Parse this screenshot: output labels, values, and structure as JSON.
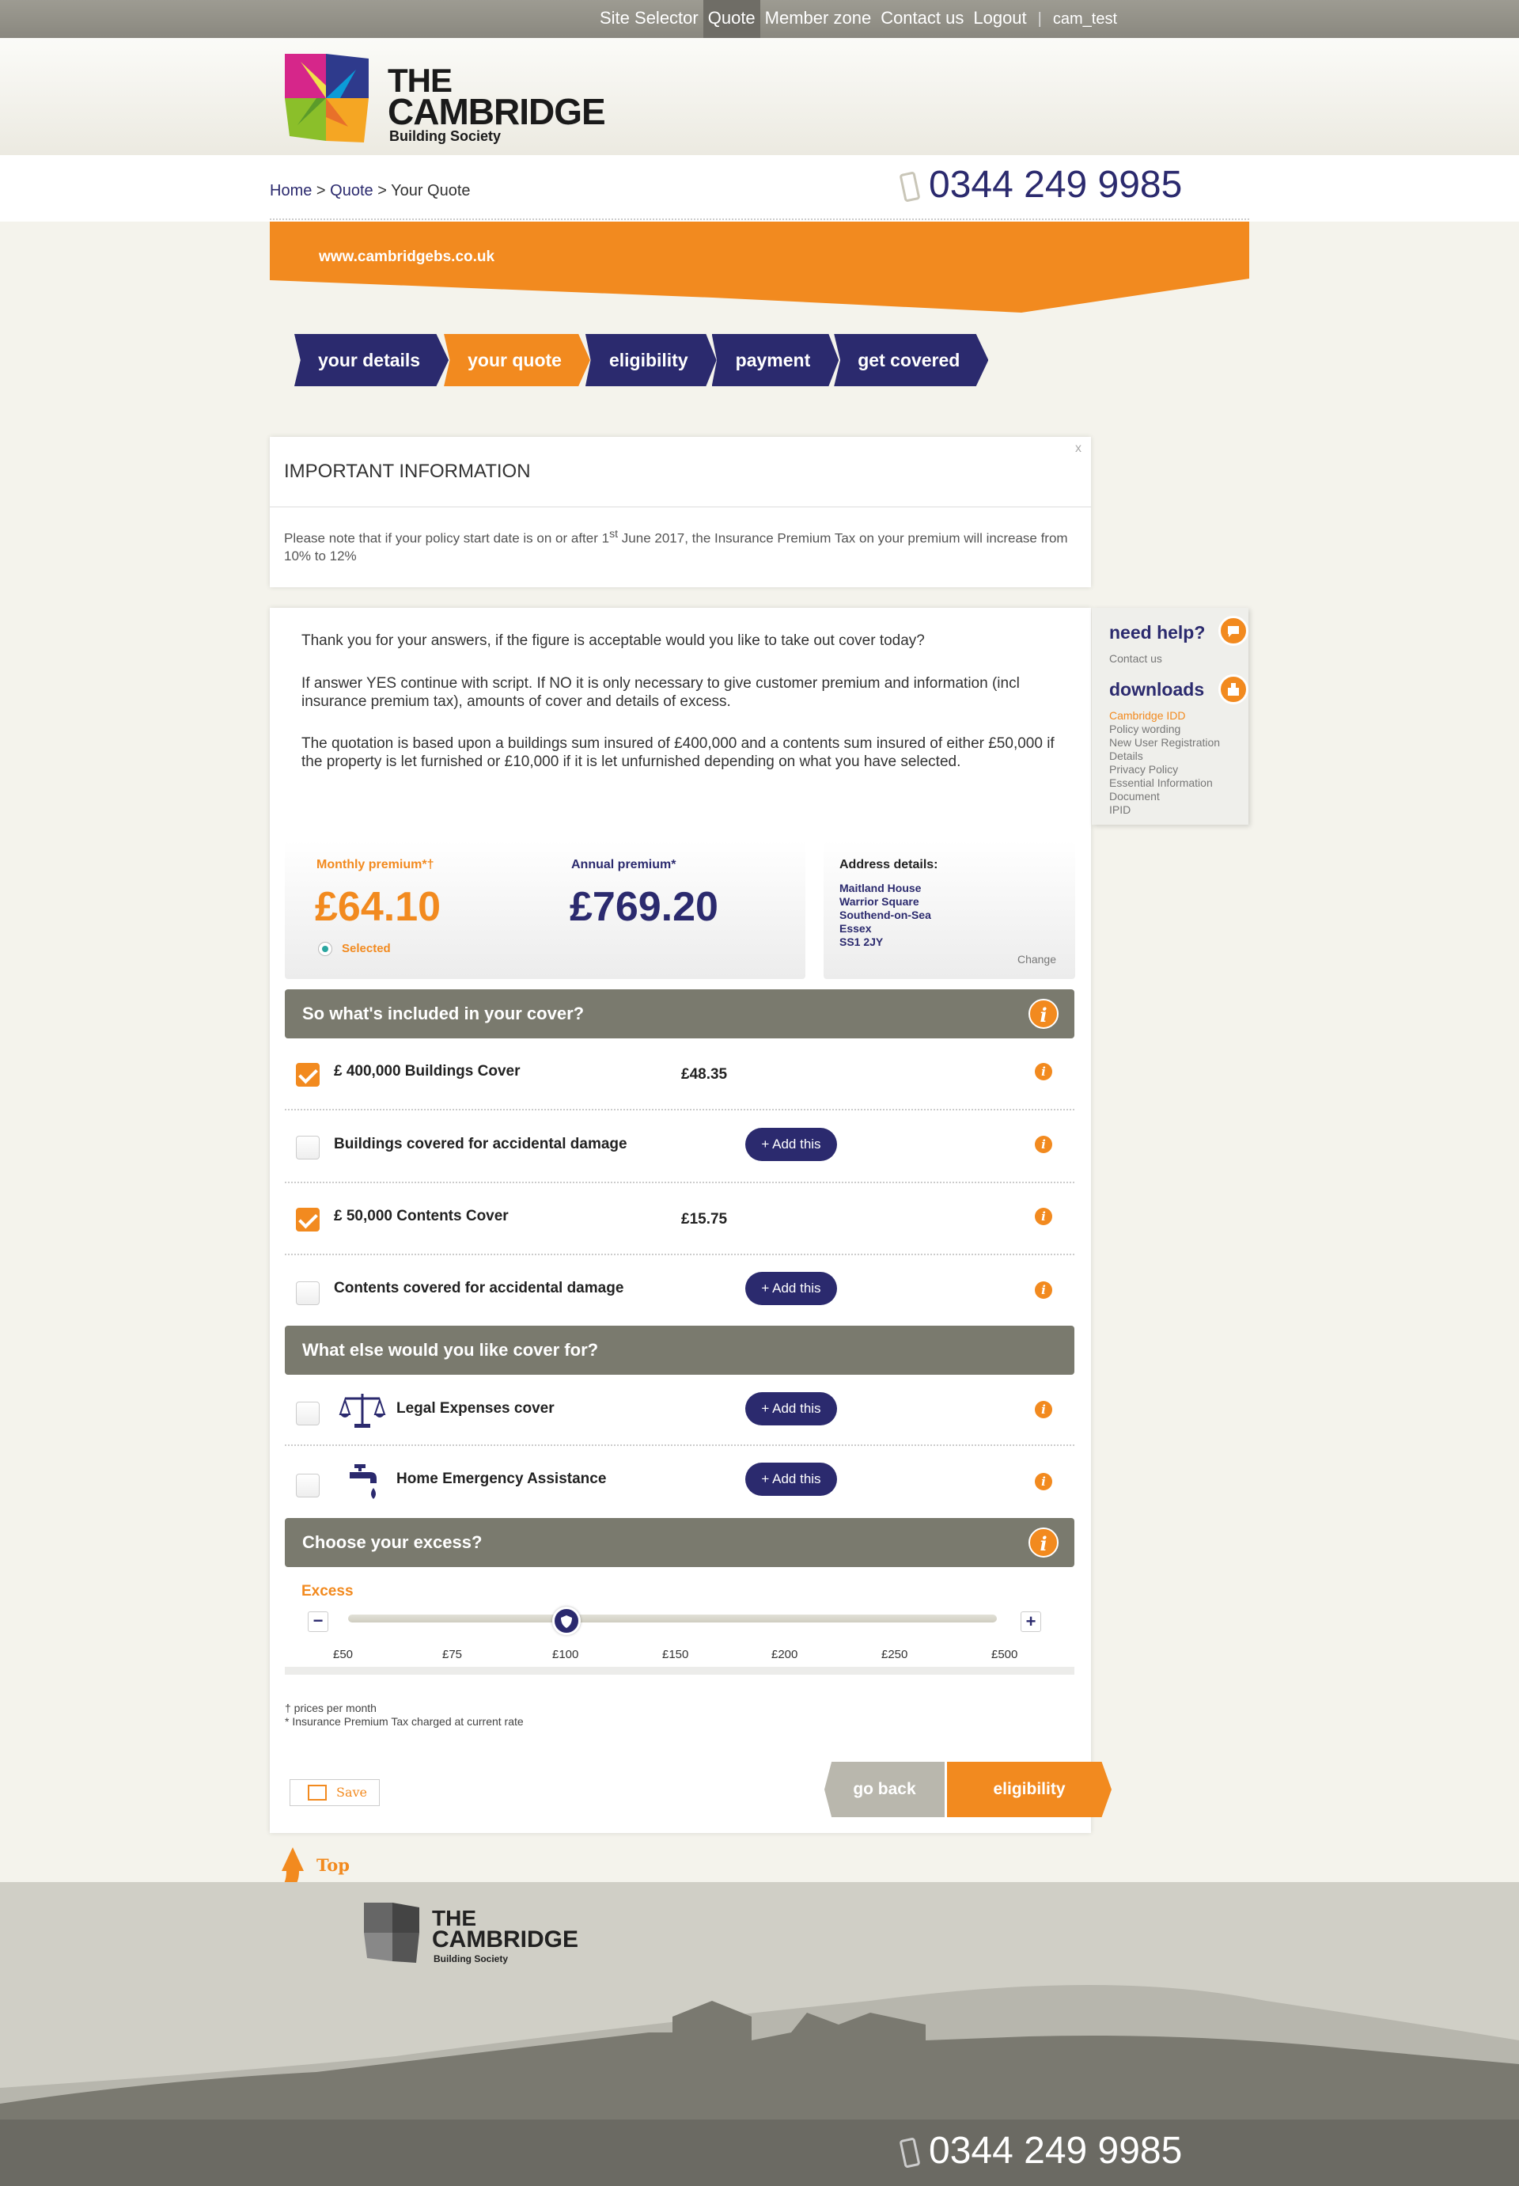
{
  "topnav": {
    "items": [
      "Site Selector",
      "Quote",
      "Member zone",
      "Contact us",
      "Logout"
    ],
    "active": "Quote",
    "user": "cam_test"
  },
  "logo": {
    "line1": "THE",
    "line2": "CAMBRIDGE",
    "line3": "Building Society"
  },
  "breadcrumb": {
    "home": "Home",
    "sep1": " > ",
    "quote": "Quote",
    "sep2": " > ",
    "current": "Your Quote"
  },
  "phone": "0344 249 9985",
  "banner": {
    "url": "www.cambridgebs.co.uk"
  },
  "steps": [
    "your details",
    "your quote",
    "eligibility",
    "payment",
    "get covered"
  ],
  "important": {
    "title": "IMPORTANT INFORMATION",
    "close": "x",
    "text_before": "Please note that if your policy start date is on or after 1",
    "sup": "st",
    "text_after": " June 2017, the Insurance Premium Tax on your premium will increase from 10% to 12%"
  },
  "script": {
    "p1": "Thank you for your answers, if the figure is acceptable would you like to take out cover today?",
    "p2": "If answer YES continue with script. If NO it is only necessary to give customer premium and information (incl insurance premium tax), amounts of cover and details of excess.",
    "p3": "The quotation is based upon a buildings sum insured of £400,000 and a contents sum insured of either £50,000 if the property is let furnished or £10,000 if it is let unfurnished depending on what you have selected."
  },
  "premium": {
    "monthly_label": "Monthly premium*†",
    "monthly_value": "£64.10",
    "selected_label": "Selected",
    "annual_label": "Annual premium*",
    "annual_value": "£769.20"
  },
  "address": {
    "label": "Address details:",
    "lines": [
      "Maitland House",
      "Warrior Square",
      "Southend-on-Sea",
      "Essex",
      "SS1 2JY"
    ],
    "change": "Change"
  },
  "included": {
    "heading": "So what's included in your cover?",
    "rows": [
      {
        "label": "£ 400,000 Buildings Cover",
        "price": "£48.35",
        "checked": true
      },
      {
        "label": "Buildings covered for accidental damage",
        "button": "+ Add this",
        "checked": false
      },
      {
        "label": "£ 50,000 Contents Cover",
        "price": "£15.75",
        "checked": true
      },
      {
        "label": "Contents covered for accidental damage",
        "button": "+ Add this",
        "checked": false
      }
    ]
  },
  "extras": {
    "heading": "What else would you like cover for?",
    "rows": [
      {
        "label": "Legal Expenses cover",
        "button": "+ Add this",
        "icon": "scales-icon"
      },
      {
        "label": "Home Emergency Assistance",
        "button": "+ Add this",
        "icon": "tap-icon"
      }
    ]
  },
  "excess": {
    "heading": "Choose your excess?",
    "label": "Excess",
    "ticks": [
      "£50",
      "£75",
      "£100",
      "£150",
      "£200",
      "£250",
      "£500"
    ],
    "selected": "£100",
    "minus": "−",
    "plus": "+"
  },
  "notes": {
    "n1": "† prices per month",
    "n2": "* Insurance Premium Tax charged at current rate"
  },
  "actions": {
    "save": "Save",
    "back": "go back",
    "next": "eligibility"
  },
  "sidebar": {
    "help_title": "need help?",
    "help_link": "Contact us",
    "downloads_title": "downloads",
    "downloads": [
      "Cambridge IDD",
      "Policy wording",
      "New User Registration",
      "Details",
      "Privacy Policy",
      "Essential Information",
      "Document",
      "IPID"
    ]
  },
  "top_link": "Top",
  "footer": {
    "phone": "0344 249 9985",
    "logo1": "THE",
    "logo2": "CAMBRIDGE",
    "logo3": "Building Society"
  },
  "colors": {
    "orange": "#f28a1f",
    "navy": "#2b2a6e",
    "grey": "#7a7a6e"
  }
}
